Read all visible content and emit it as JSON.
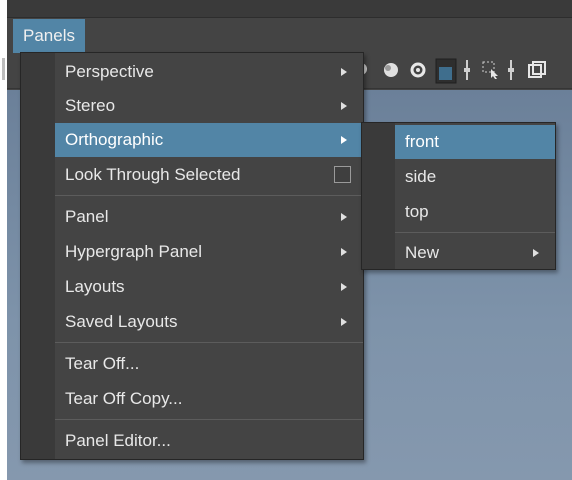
{
  "menubar": {
    "panels_label": "Panels"
  },
  "panels_menu": {
    "items": [
      {
        "label": "Perspective",
        "submenu": true
      },
      {
        "label": "Stereo",
        "submenu": true
      },
      {
        "label": "Orthographic",
        "submenu": true,
        "active": true
      },
      {
        "label": "Look Through Selected",
        "checkbox": true,
        "checked": false
      },
      {
        "label": "Panel",
        "submenu": true
      },
      {
        "label": "Hypergraph Panel",
        "submenu": true
      },
      {
        "label": "Layouts",
        "submenu": true
      },
      {
        "label": "Saved Layouts",
        "submenu": true
      },
      {
        "label": "Tear Off..."
      },
      {
        "label": "Tear Off Copy..."
      },
      {
        "label": "Panel Editor..."
      }
    ]
  },
  "orthographic_submenu": {
    "items": [
      {
        "label": "front",
        "active": true
      },
      {
        "label": "side"
      },
      {
        "label": "top"
      },
      {
        "label": "New",
        "submenu": true
      }
    ]
  },
  "colors": {
    "highlight": "#5285a6",
    "menu_bg": "#444444",
    "viewport_top": "#6b8099"
  },
  "toolbar": {
    "icons": [
      "light-bulb-icon",
      "sphere-shaded-icon",
      "ring-icon",
      "xray-box-icon",
      "separator-icon",
      "select-region-icon",
      "separator-icon",
      "window-icon"
    ]
  }
}
